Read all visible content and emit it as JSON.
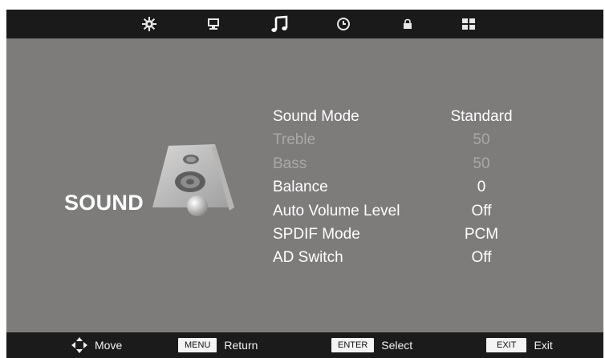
{
  "topbar": {
    "tabs": [
      {
        "icon": "gear-icon",
        "active": false
      },
      {
        "icon": "monitor-icon",
        "active": false
      },
      {
        "icon": "music-note-icon",
        "active": true
      },
      {
        "icon": "clock-icon",
        "active": false
      },
      {
        "icon": "lock-icon",
        "active": false
      },
      {
        "icon": "grid-icon",
        "active": false
      }
    ]
  },
  "section": {
    "title": "SOUND",
    "icon": "speaker-icon"
  },
  "menu": {
    "items": [
      {
        "label": "Sound Mode",
        "value": "Standard",
        "enabled": true
      },
      {
        "label": "Treble",
        "value": "50",
        "enabled": false
      },
      {
        "label": "Bass",
        "value": "50",
        "enabled": false
      },
      {
        "label": "Balance",
        "value": "0",
        "enabled": true
      },
      {
        "label": "Auto Volume Level",
        "value": "Off",
        "enabled": true
      },
      {
        "label": "SPDIF Mode",
        "value": "PCM",
        "enabled": true
      },
      {
        "label": "AD Switch",
        "value": "Off",
        "enabled": true
      }
    ]
  },
  "footer": {
    "move": {
      "icon": "arrows-icon",
      "label": "Move"
    },
    "menu": {
      "key": "MENU",
      "label": "Return"
    },
    "enter": {
      "key": "ENTER",
      "label": "Select"
    },
    "exit": {
      "key": "EXIT",
      "label": "Exit"
    }
  },
  "colors": {
    "background": "#7d7c7b",
    "bars": "#1a1a1a",
    "text": "#ffffff",
    "disabled_text": "#a9a8a7"
  }
}
